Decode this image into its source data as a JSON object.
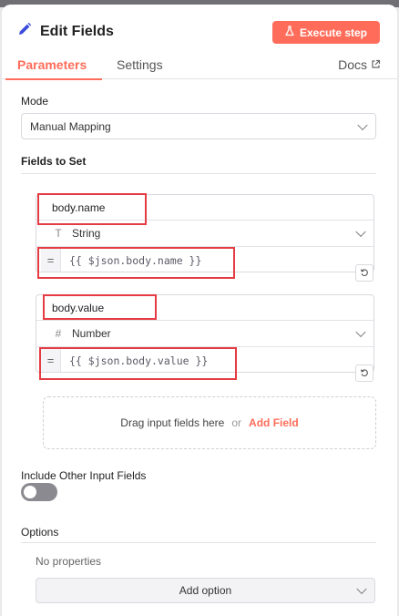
{
  "header": {
    "title": "Edit Fields",
    "execute_label": "Execute step",
    "accent_color": "#ff6d5a"
  },
  "tabs": [
    {
      "label": "Parameters",
      "active": true
    },
    {
      "label": "Settings",
      "active": false
    }
  ],
  "docs_label": "Docs",
  "mode": {
    "label": "Mode",
    "value": "Manual Mapping"
  },
  "fields_to_set": {
    "label": "Fields to Set",
    "assignments": [
      {
        "name": "body.name",
        "type": "String",
        "type_icon": "T",
        "value": "{{ $json.body.name }}"
      },
      {
        "name": "body.value",
        "type": "Number",
        "type_icon": "#",
        "value": "{{ $json.body.value }}"
      }
    ],
    "drop_text": "Drag input fields here",
    "or_text": "or",
    "add_field_label": "Add Field"
  },
  "include_other": {
    "label": "Include Other Input Fields",
    "enabled": false
  },
  "options": {
    "label": "Options",
    "empty_text": "No properties",
    "add_option_label": "Add option"
  },
  "highlight_color": "#e53b42"
}
